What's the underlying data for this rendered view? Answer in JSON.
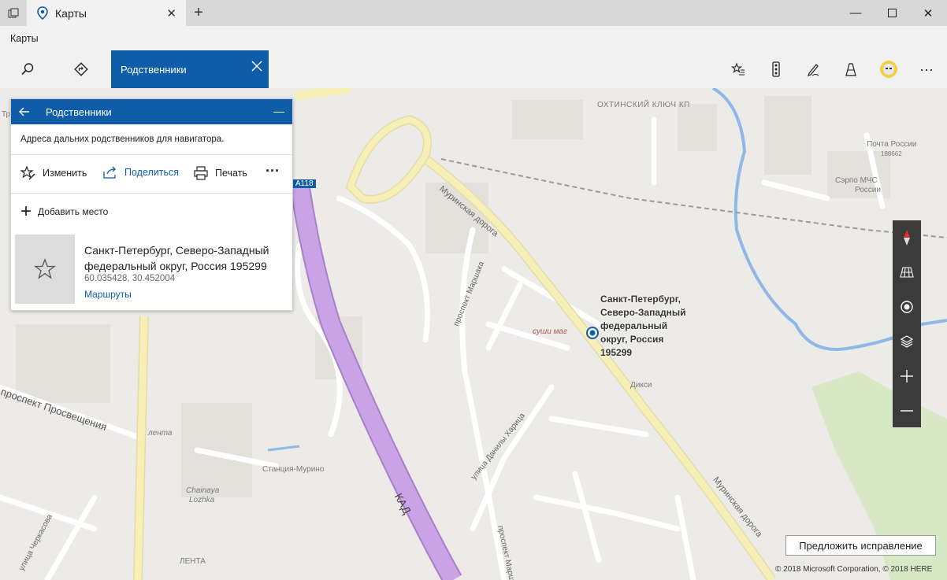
{
  "window": {
    "tab_title": "Карты",
    "app_title": "Карты"
  },
  "toolbar": {
    "active_tab_label": "Родственники"
  },
  "panel": {
    "title": "Родственники",
    "description": "Адреса дальних родственников для навигатора.",
    "actions": {
      "edit": "Изменить",
      "share": "Поделиться",
      "print": "Печать",
      "more": "···"
    },
    "add_place": "Добавить место",
    "place": {
      "address": "Санкт-Петербург, Северо-Западный федеральный округ, Россия 195299",
      "coords": "60.035428, 30.452004",
      "routes": "Маршруты"
    }
  },
  "map": {
    "labels": {
      "ohtinsky": "ОХТИНСКИЙ КЛЮЧ КП",
      "post": "Почта России",
      "post_code": "188662",
      "mchs": "Сэрпо МЧС",
      "mchs2": "России",
      "murinskaya1": "Муринская дорога",
      "murinskaya2": "Муринская дорога",
      "marshaka": "проспект Маршака",
      "marshaka2": "проспект Маршака",
      "prosvesh": "проспект Просвещения",
      "kharitsa": "улица Данилы Харица",
      "cherkasova": "улица Черкасова",
      "murino": "Станция-Мурино",
      "chainaya": "Chainaya",
      "lozhka": "Lozhka",
      "lenta1": "лента",
      "lenta2": "ЛЕНТА",
      "sushi": "суши маг",
      "dixi": "Дикси",
      "kad": "КАД",
      "a118": "А118",
      "tr": "Тр"
    },
    "pin_label": "Санкт-Петербург, Северо-Западный федеральный округ, Россия 195299",
    "suggest": "Предложить исправление",
    "copyright": "© 2018 Microsoft Corporation, © 2018 HERE"
  },
  "colors": {
    "accent": "#0f5da8",
    "ring_road": "#c9a3e6",
    "major_road": "#f7efb8"
  }
}
